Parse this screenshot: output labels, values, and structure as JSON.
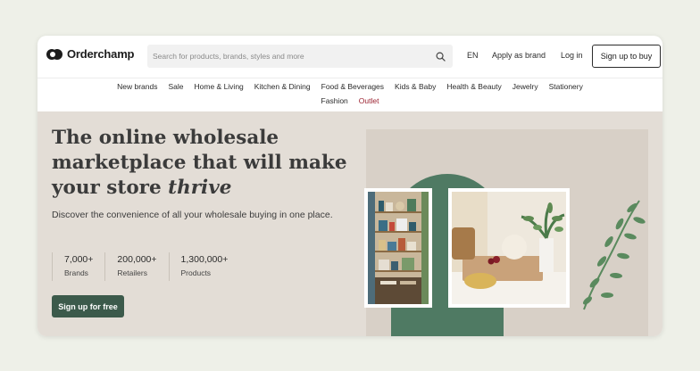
{
  "brand": {
    "name": "Orderchamp"
  },
  "search": {
    "placeholder": "Search for products, brands, styles and more"
  },
  "header": {
    "lang": "EN",
    "apply": "Apply as brand",
    "login": "Log in",
    "signup": "Sign up to buy"
  },
  "nav": {
    "row1": [
      "New brands",
      "Sale",
      "Home & Living",
      "Kitchen & Dining",
      "Food & Beverages",
      "Kids & Baby",
      "Health & Beauty",
      "Jewelry",
      "Stationery"
    ],
    "row2": [
      "Fashion",
      "Outlet"
    ]
  },
  "hero": {
    "title_line1": "The online wholesale",
    "title_line2": "marketplace that will make",
    "title_line3_prefix": "your store ",
    "title_line3_em": "thrive",
    "subtitle": "Discover the convenience of all your wholesale buying in one place.",
    "stats": [
      {
        "value": "7,000+",
        "label": "Brands"
      },
      {
        "value": "200,000+",
        "label": "Retailers"
      },
      {
        "value": "1,300,000+",
        "label": "Products"
      }
    ],
    "cta": "Sign up for free"
  },
  "colors": {
    "hero_bg": "#e3ddd6",
    "cta_bg": "#3c5a4b",
    "arch": "#4f7a63",
    "outlet": "#9b2230"
  },
  "icons": {
    "search": "search-icon",
    "logo": "orderchamp-logo-icon"
  }
}
